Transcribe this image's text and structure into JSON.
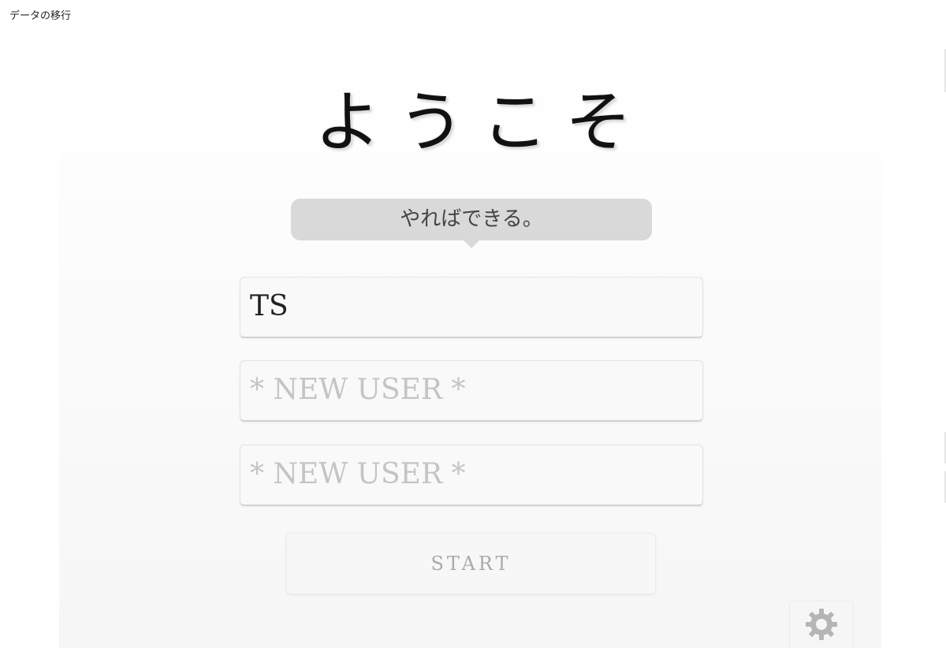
{
  "window": {
    "title": "データの移行"
  },
  "welcome": {
    "title": "ようこそ",
    "tagline": "やればできる。"
  },
  "user_slots": [
    {
      "value": "TS",
      "is_placeholder": false
    },
    {
      "value": "* NEW USER *",
      "is_placeholder": true
    },
    {
      "value": "* NEW USER *",
      "is_placeholder": true
    }
  ],
  "actions": {
    "start_label": "START",
    "settings_icon": "gear-icon"
  },
  "colors": {
    "bubble": "#d9d9d9",
    "placeholder_text": "#c4c4c4",
    "start_text": "#aaaaaa",
    "gear": "#b5b5b5"
  }
}
